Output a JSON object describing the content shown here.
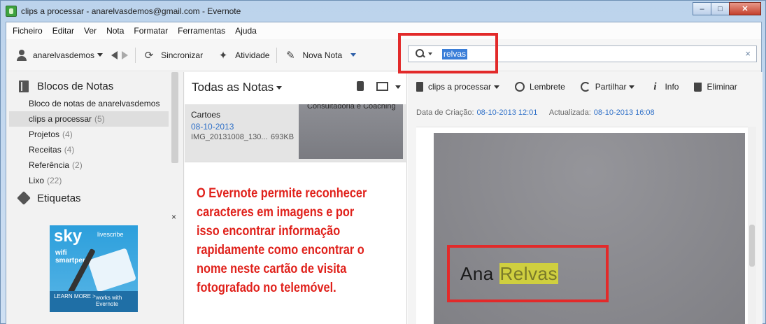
{
  "window": {
    "title": "clips a processar - anarelvasdemos@gmail.com - Evernote",
    "controls": {
      "minimize": "–",
      "maximize": "□",
      "close": "✕"
    }
  },
  "menubar": [
    "Ficheiro",
    "Editar",
    "Ver",
    "Nota",
    "Formatar",
    "Ferramentas",
    "Ajuda"
  ],
  "toolbar": {
    "user": "anarelvasdemos",
    "sync": "Sincronizar",
    "activity": "Atividade",
    "new_note": "Nova Nota"
  },
  "search": {
    "value": "relvas",
    "clear": "×"
  },
  "sidebar": {
    "notebooks_heading": "Blocos de Notas",
    "items": [
      {
        "label": "Bloco de notas de anarelvasdemos",
        "count": ""
      },
      {
        "label": "clips a processar",
        "count": "(5)"
      },
      {
        "label": "Projetos",
        "count": "(4)"
      },
      {
        "label": "Receitas",
        "count": "(4)"
      },
      {
        "label": "Referência",
        "count": "(2)"
      },
      {
        "label": "Lixo",
        "count": "(22)"
      }
    ],
    "tags_heading": "Etiquetas",
    "ad": {
      "close": "×",
      "sky": "sky",
      "brand": "livescribe",
      "line1": "wifi",
      "line2": "smartpen",
      "learn": "LEARN MORE >",
      "works": "works with Evernote"
    }
  },
  "notelist": {
    "header": "Todas as Notas",
    "note": {
      "title": "Cartoes",
      "date": "08-10-2013",
      "file": "IMG_20131008_130...",
      "size": "693KB",
      "thumb_text": "Consultadoria e Coaching"
    },
    "annotation": "O Evernote permite reconhecer caracteres em imagens e por isso encontrar informação rapidamente como encontrar o nome neste cartão de visita fotografado no telemóvel."
  },
  "noteview": {
    "notebook": "clips a processar",
    "reminder": "Lembrete",
    "share": "Partilhar",
    "info": "Info",
    "delete": "Eliminar",
    "created_label": "Data de Criação:",
    "created_value": "08-10-2013 12:01",
    "updated_label": "Actualizada:",
    "updated_value": "08-10-2013 16:08",
    "card_first_name": "Ana",
    "card_last_name": "Relvas"
  },
  "colors": {
    "annotation_red": "#e0211b",
    "search_highlight": "#3a7ed8",
    "ocr_highlight": "#cfcf3f",
    "link_blue": "#2f70c8"
  }
}
